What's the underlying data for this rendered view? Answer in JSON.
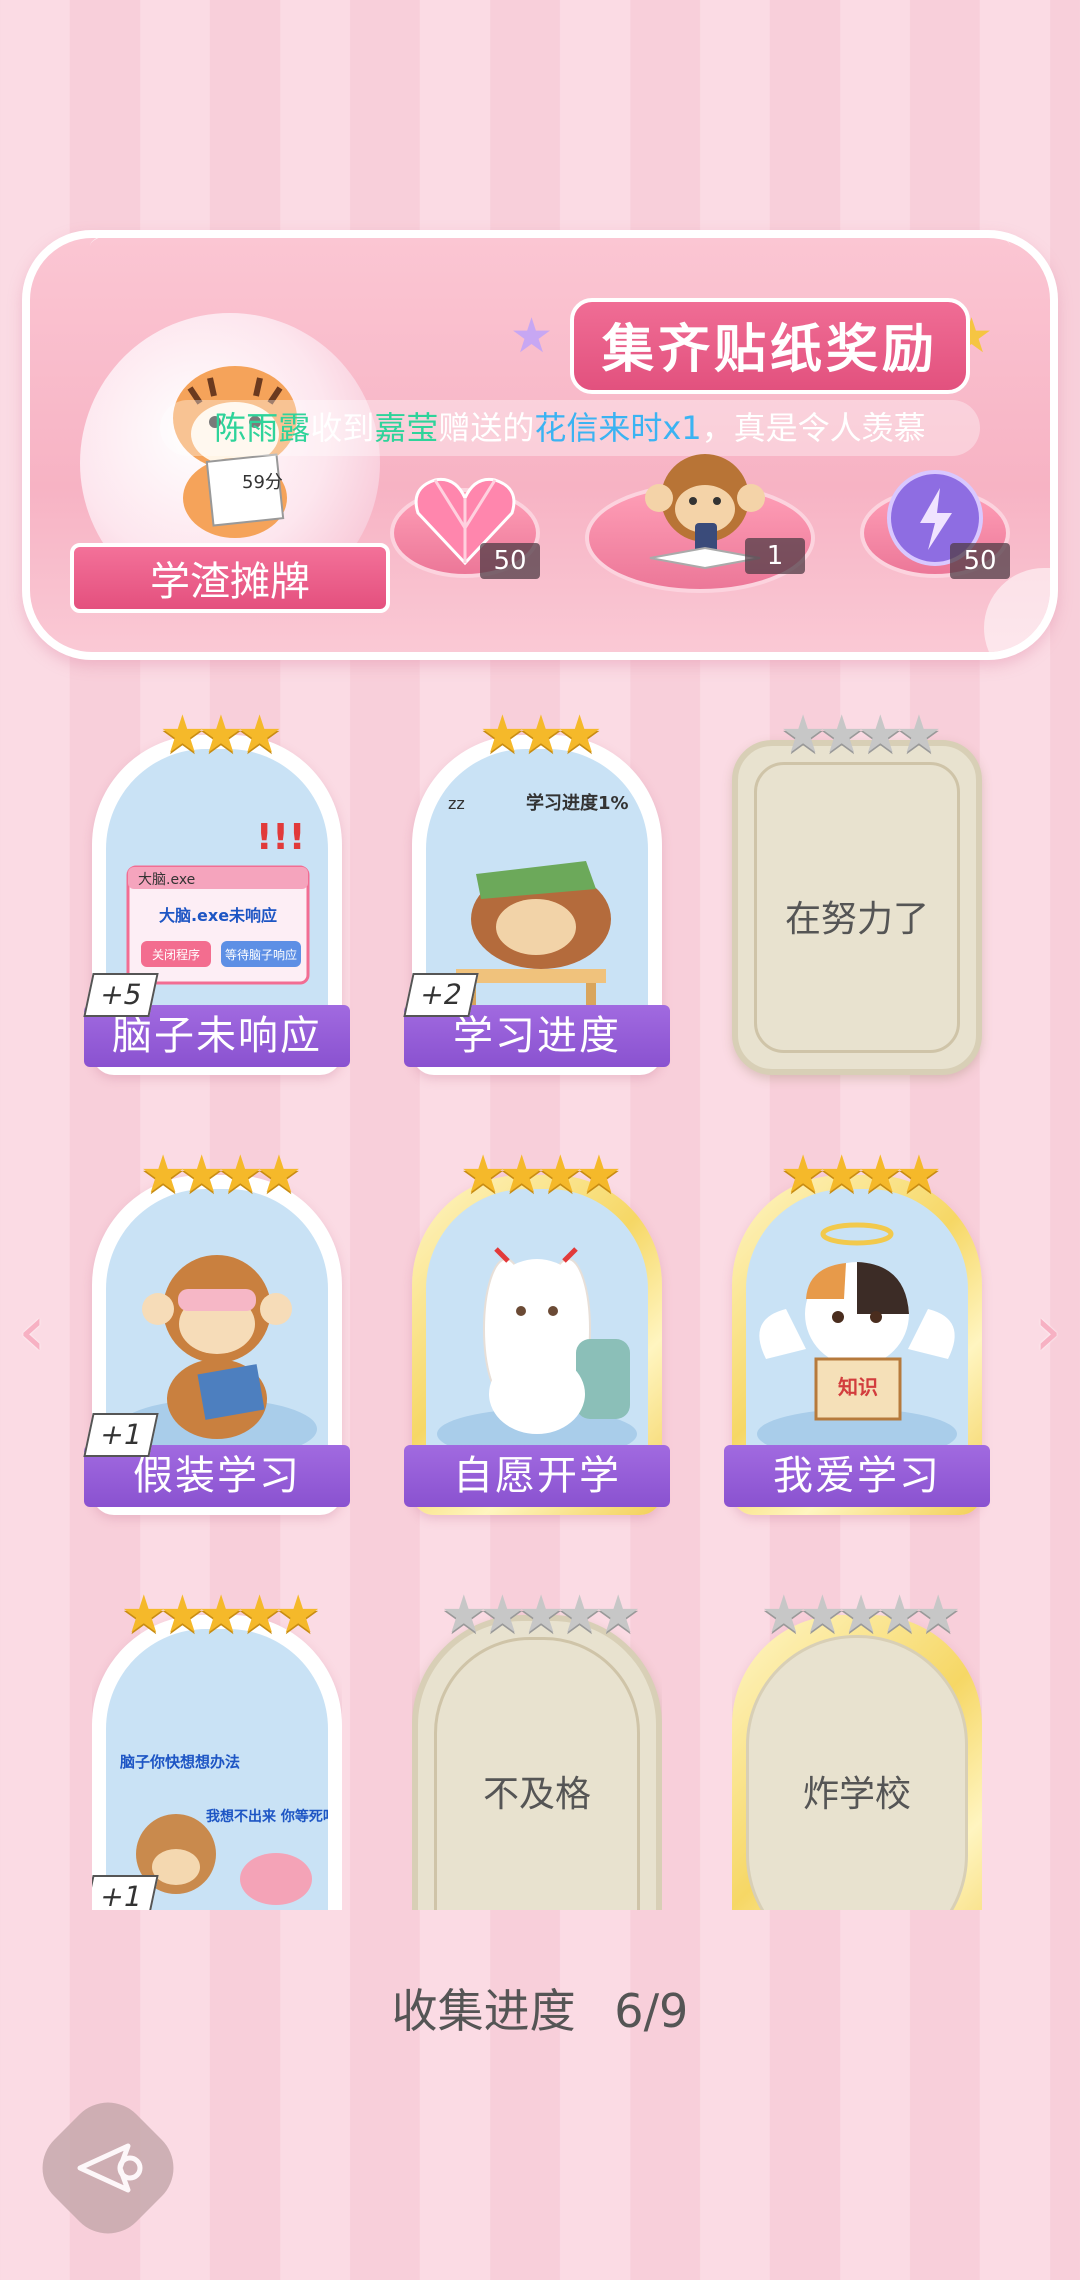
{
  "banner": {
    "title": "集齐贴纸奖励",
    "notice": {
      "name1": "陈雨露",
      "text1": "收到",
      "name2": "嘉莹",
      "text2": "赠送的",
      "gift": "花信来时x1",
      "text3": "，真是令人羡慕"
    },
    "tiger_sign": "59分",
    "tiger_label": "学渣摊牌",
    "rewards": [
      {
        "icon": "pink-heart-gem-icon",
        "count": "50"
      },
      {
        "icon": "monkey-phone-icon",
        "count": "1"
      },
      {
        "icon": "purple-energy-orb-icon",
        "count": "50"
      }
    ]
  },
  "cards": [
    {
      "name": "脑子未响应",
      "stars": 3,
      "max_stars": 3,
      "plus": "+5",
      "owned": true,
      "art_text": [
        "大脑.exe",
        "大脑.exe未响应",
        "关闭程序",
        "等待脑子响应"
      ]
    },
    {
      "name": "学习进度",
      "stars": 3,
      "max_stars": 3,
      "plus": "+2",
      "owned": true,
      "art_text": [
        "学习进度1%",
        "zz"
      ]
    },
    {
      "name": "在努力了",
      "stars": 0,
      "max_stars": 4,
      "owned": false
    },
    {
      "name": "假装学习",
      "stars": 4,
      "max_stars": 4,
      "plus": "+1",
      "owned": true
    },
    {
      "name": "自愿开学",
      "stars": 4,
      "max_stars": 4,
      "owned": true
    },
    {
      "name": "我爱学习",
      "stars": 4,
      "max_stars": 4,
      "owned": true,
      "art_text": [
        "知识"
      ]
    },
    {
      "name": "",
      "stars": 5,
      "max_stars": 5,
      "plus": "+1",
      "owned": true,
      "art_text": [
        "脑子你快想想办法",
        "我想不出来 你等死吧"
      ]
    },
    {
      "name": "不及格",
      "stars": 0,
      "max_stars": 5,
      "owned": false
    },
    {
      "name": "炸学校",
      "stars": 0,
      "max_stars": 5,
      "owned": false
    }
  ],
  "progress": {
    "label": "收集进度",
    "value": "6/9",
    "collected": 6,
    "total": 9
  },
  "nav": {
    "prev_icon": "chevron-left-icon",
    "next_icon": "chevron-right-icon",
    "back_icon": "back-arrow-icon"
  },
  "colors": {
    "ribbon_purple": "#8a52d0",
    "banner_pink": "#f06d95",
    "star_gold": "#f5b92a",
    "star_gray": "#c7c7c7"
  }
}
